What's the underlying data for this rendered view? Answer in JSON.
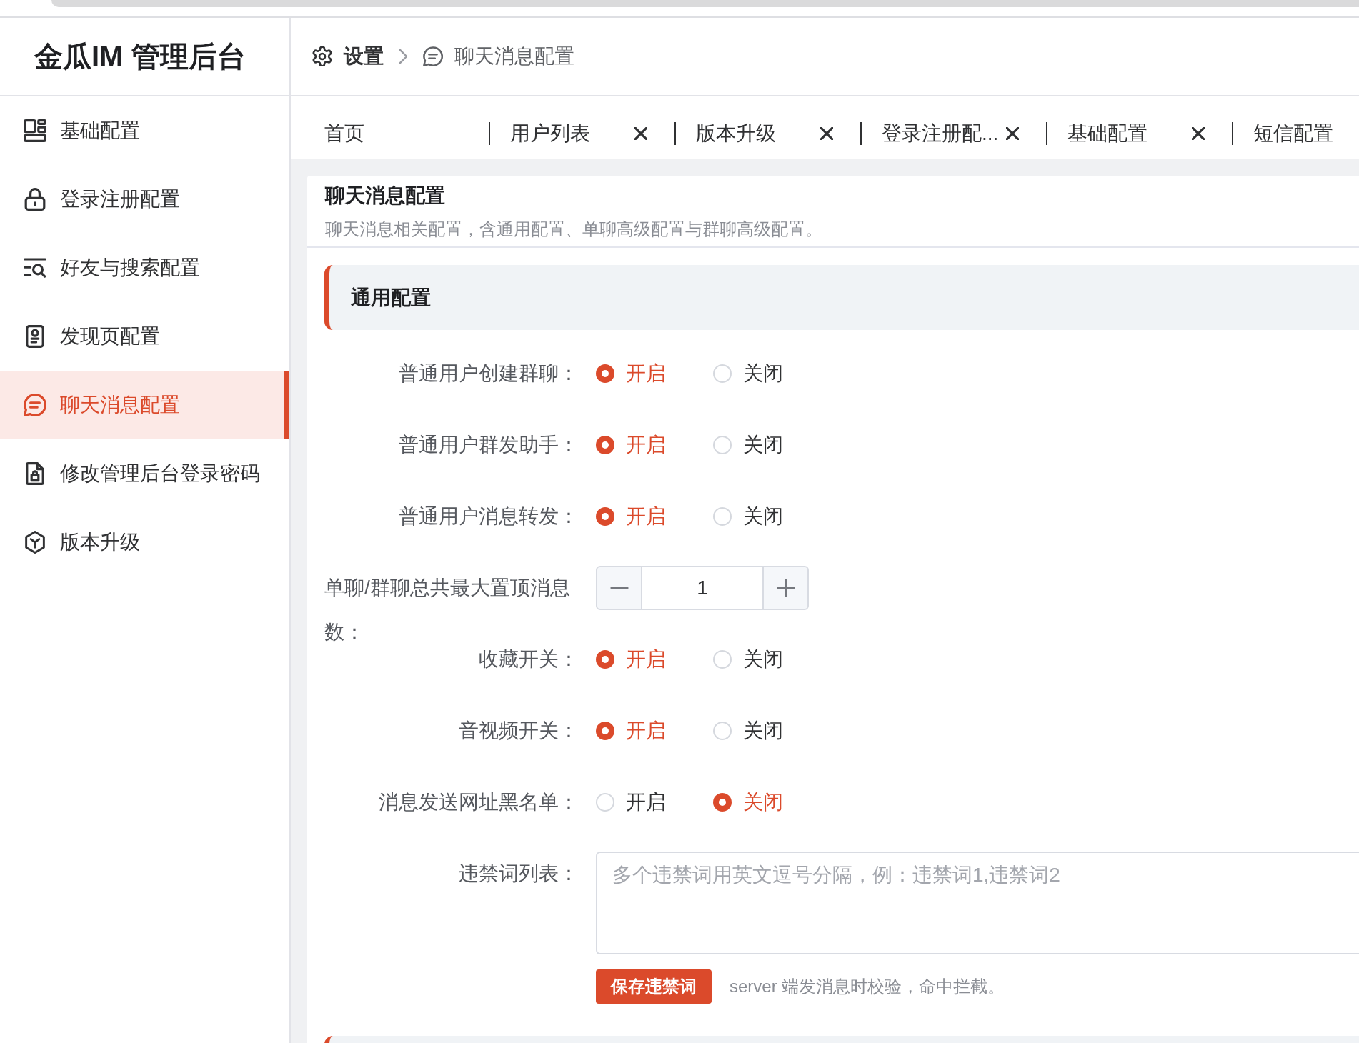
{
  "sidebar": {
    "title": "金瓜IM 管理后台",
    "items": [
      {
        "label": "基础配置",
        "selected": false
      },
      {
        "label": "登录注册配置",
        "selected": false
      },
      {
        "label": "好友与搜索配置",
        "selected": false
      },
      {
        "label": "发现页配置",
        "selected": false
      },
      {
        "label": "聊天消息配置",
        "selected": true
      },
      {
        "label": "修改管理后台登录密码",
        "selected": false
      },
      {
        "label": "版本升级",
        "selected": false
      }
    ]
  },
  "breadcrumb": [
    {
      "label": "设置",
      "current": false
    },
    {
      "label": "聊天消息配置",
      "current": true
    }
  ],
  "tabs": [
    {
      "label": "首页",
      "closable": false,
      "selected": false
    },
    {
      "label": "用户列表",
      "closable": true,
      "selected": false
    },
    {
      "label": "版本升级",
      "closable": true,
      "selected": false
    },
    {
      "label": "登录注册配...",
      "closable": true,
      "selected": false
    },
    {
      "label": "基础配置",
      "closable": true,
      "selected": false
    },
    {
      "label": "短信配置",
      "closable": false,
      "selected": false
    }
  ],
  "card": {
    "title": "聊天消息配置",
    "description": "聊天消息相关配置，含通用配置、单聊高级配置与群聊高级配置。"
  },
  "section": {
    "title": "通用配置",
    "rows": [
      {
        "kind": "radio",
        "label": "普通用户创建群聊：",
        "options": [
          {
            "label": "开启",
            "selected": true
          },
          {
            "label": "关闭",
            "selected": false
          }
        ]
      },
      {
        "kind": "radio",
        "label": "普通用户群发助手：",
        "options": [
          {
            "label": "开启",
            "selected": true
          },
          {
            "label": "关闭",
            "selected": false
          }
        ]
      },
      {
        "kind": "radio",
        "label": "普通用户消息转发：",
        "options": [
          {
            "label": "开启",
            "selected": true
          },
          {
            "label": "关闭",
            "selected": false
          }
        ]
      },
      {
        "kind": "stepper",
        "label": "单聊/群聊总共最大置顶消息数：",
        "value": "1"
      },
      {
        "kind": "radio",
        "label": "收藏开关：",
        "options": [
          {
            "label": "开启",
            "selected": true
          },
          {
            "label": "关闭",
            "selected": false
          }
        ]
      },
      {
        "kind": "radio",
        "label": "音视频开关：",
        "options": [
          {
            "label": "开启",
            "selected": true
          },
          {
            "label": "关闭",
            "selected": false
          }
        ]
      },
      {
        "kind": "radio",
        "label": "消息发送网址黑名单：",
        "options": [
          {
            "label": "开启",
            "selected": false
          },
          {
            "label": "关闭",
            "selected": true
          }
        ]
      },
      {
        "kind": "textarea",
        "label": "违禁词列表：",
        "placeholder": "多个违禁词用英文逗号分隔，例：违禁词1,违禁词2",
        "button": "保存违禁词",
        "help": "server 端发消息时校验，命中拦截。"
      }
    ]
  }
}
